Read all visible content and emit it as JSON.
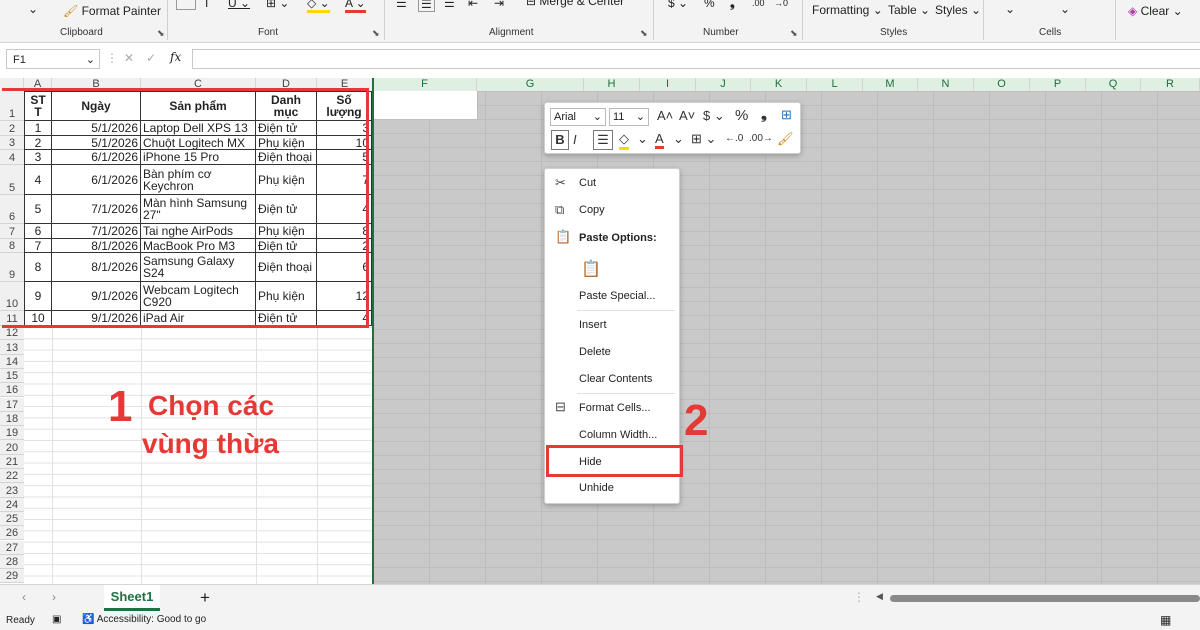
{
  "ribbon": {
    "format_painter": "Format Painter",
    "clipboard_label": "Clipboard",
    "font_label": "Font",
    "alignment_label": "Alignment",
    "merge_center": "Merge & Center",
    "number_label": "Number",
    "formatting": "Formatting",
    "table": "Table",
    "styles_btn": "Styles",
    "styles_label": "Styles",
    "cells_label": "Cells",
    "clear": "Clear"
  },
  "formula_bar": {
    "name_box": "F1",
    "fx": "fx",
    "value": ""
  },
  "columns": [
    "A",
    "B",
    "C",
    "D",
    "E",
    "F",
    "G",
    "H",
    "I",
    "J",
    "K",
    "L",
    "M",
    "N",
    "O",
    "P",
    "Q",
    "R"
  ],
  "rows": [
    "1",
    "2",
    "3",
    "4",
    "5",
    "6",
    "7",
    "8",
    "9",
    "10",
    "11",
    "12",
    "13",
    "14",
    "15",
    "16",
    "17",
    "18",
    "19",
    "20",
    "21",
    "22",
    "23",
    "24",
    "25",
    "26",
    "27",
    "28",
    "29"
  ],
  "table": {
    "headers": [
      "ST\nT",
      "Ngày",
      "Sản phẩm",
      "Danh\nmục",
      "Số\nlượng"
    ],
    "rows": [
      [
        "1",
        "5/1/2026",
        "Laptop Dell XPS 13",
        "Điện tử",
        "3"
      ],
      [
        "2",
        "5/1/2026",
        "Chuột Logitech MX",
        "Phụ kiện",
        "10"
      ],
      [
        "3",
        "6/1/2026",
        "iPhone 15 Pro",
        "Điện thoại",
        "5"
      ],
      [
        "4",
        "6/1/2026",
        "Bàn phím cơ Keychron",
        "Phụ kiện",
        "7"
      ],
      [
        "5",
        "7/1/2026",
        "Màn hình Samsung 27\"",
        "Điện tử",
        "4"
      ],
      [
        "6",
        "7/1/2026",
        "Tai nghe AirPods",
        "Phụ kiện",
        "8"
      ],
      [
        "7",
        "8/1/2026",
        "MacBook Pro M3",
        "Điện tử",
        "2"
      ],
      [
        "8",
        "8/1/2026",
        "Samsung Galaxy S24",
        "Điện thoại",
        "6"
      ],
      [
        "9",
        "9/1/2026",
        "Webcam Logitech C920",
        "Phụ kiện",
        "12"
      ],
      [
        "10",
        "9/1/2026",
        "iPad Air",
        "Điện tử",
        "4"
      ]
    ]
  },
  "mini_toolbar": {
    "font": "Arial",
    "size": "11"
  },
  "context_menu": {
    "cut": "Cut",
    "copy": "Copy",
    "paste_options": "Paste Options:",
    "paste_special": "Paste Special...",
    "insert": "Insert",
    "delete": "Delete",
    "clear_contents": "Clear Contents",
    "format_cells": "Format Cells...",
    "column_width": "Column Width...",
    "hide": "Hide",
    "unhide": "Unhide"
  },
  "annotations": {
    "step1_number": "1",
    "step1_text_line1": "Chọn các",
    "step1_text_line2": "vùng thừa",
    "step2_number": "2",
    "color": "#e53935"
  },
  "sheet_tabs": {
    "active": "Sheet1",
    "add": "+"
  },
  "status": {
    "ready": "Ready",
    "accessibility": "Accessibility: Good to go"
  }
}
